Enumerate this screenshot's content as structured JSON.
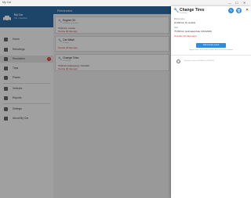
{
  "window": {
    "title": "My Car",
    "controls": [
      "—",
      "☐",
      "✕"
    ]
  },
  "sidebar": {
    "car_name": "My Car",
    "car_sub": "Car • Gasoline",
    "items": [
      {
        "label": "Home",
        "icon": "home-icon"
      },
      {
        "label": "Refuelings",
        "icon": "fuel-icon"
      },
      {
        "label": "Reminders",
        "icon": "bell-icon",
        "badge": "2"
      },
      {
        "label": "Trips",
        "icon": "car-icon"
      },
      {
        "label": "Places",
        "icon": "place-icon"
      },
      {
        "label": "Vehicles",
        "icon": "vehicle-icon"
      },
      {
        "label": "Reports",
        "icon": "chart-icon"
      },
      {
        "label": "Settings",
        "icon": "gear-icon"
      },
      {
        "label": "About My Car",
        "icon": "info-icon"
      }
    ]
  },
  "main": {
    "title": "Reminders",
    "reminders": [
      {
        "title": "Engine Oil",
        "sub": "5,000 km • 6 months",
        "line": "75,000 km • overdue",
        "due": "Overdue (64 days ago)"
      },
      {
        "title": "Car Wash",
        "sub": "15 days",
        "line": "Overdue (30 days ago)",
        "due": ""
      },
      {
        "title": "Change Tires",
        "sub": "15,000 km",
        "line": "75,000 km (maintenance) • 6/10/2022",
        "due": "Overdue (64 days ago)"
      }
    ]
  },
  "detail": {
    "title": "Change Tires",
    "subhead": "15,000 km",
    "section1_label": "Maintenance",
    "section1_value": "15,000 km (6 months)",
    "section2_label": "Next",
    "section2_value": "75,000 km (estimated date: 6/10/2022)",
    "overdue": "Overdue (64 days ago)",
    "add_button": "Add service event",
    "add_hint": "Register when the service has been done to track this reminder",
    "history": "Previous service: 60,000 km (1/1/2022)",
    "edit_icon": "edit-icon",
    "delete_icon": "delete-icon",
    "close": "✕",
    "colors": {
      "accent": "#2e8be0",
      "header": "#2e6da4",
      "overdue": "#d32f2f"
    }
  }
}
